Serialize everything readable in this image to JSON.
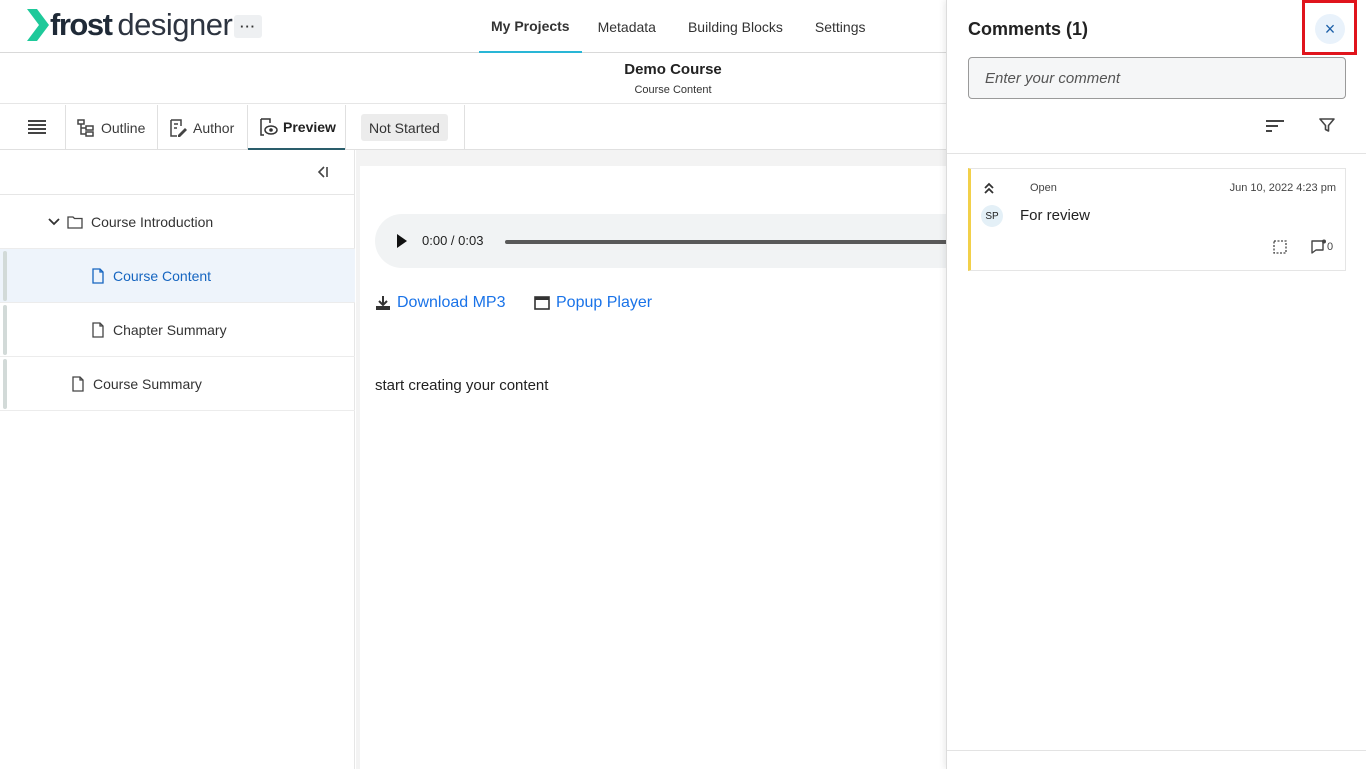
{
  "app": {
    "logo_frost": "frost",
    "logo_designer": "designer",
    "more_label": "···",
    "accent_color": "#29b6d6",
    "logo_color": "#1ec99a"
  },
  "topnav": {
    "items": [
      {
        "label": "My Projects",
        "active": true
      },
      {
        "label": "Metadata"
      },
      {
        "label": "Building Blocks"
      },
      {
        "label": "Settings"
      }
    ]
  },
  "course": {
    "title": "Demo Course",
    "subtitle": "Course Content"
  },
  "toolbar": {
    "menu_icon": "hamburger-icon",
    "tabs": [
      {
        "label": "Outline",
        "icon": "outline-tree-icon"
      },
      {
        "label": "Author",
        "icon": "edit-document-icon"
      },
      {
        "label": "Preview",
        "icon": "preview-eye-icon",
        "active": true
      }
    ],
    "status": "Not Started"
  },
  "sidebar": {
    "collapse_icon": "collapse-left-icon",
    "items": [
      {
        "label": "Course Introduction",
        "type": "folder",
        "expanded": true
      },
      {
        "label": "Course Content",
        "type": "page",
        "selected": true
      },
      {
        "label": "Chapter Summary",
        "type": "page"
      },
      {
        "label": "Course Summary",
        "type": "page"
      }
    ]
  },
  "content": {
    "audio_time": "0:00 / 0:03",
    "download_label": "Download MP3",
    "popup_label": "Popup Player",
    "body_text": "start creating your content"
  },
  "comments": {
    "title": "Comments (1)",
    "close_label": "×",
    "input_placeholder": "Enter your comment",
    "sort_icon": "sort-icon",
    "filter_icon": "filter-icon",
    "items": [
      {
        "priority_icon": "double-chevron-up-icon",
        "status": "Open",
        "date": "Jun 10, 2022 4:23 pm",
        "avatar": "SP",
        "text": "For review",
        "reply_count": "0",
        "status_color": "#f2d04a"
      }
    ]
  }
}
